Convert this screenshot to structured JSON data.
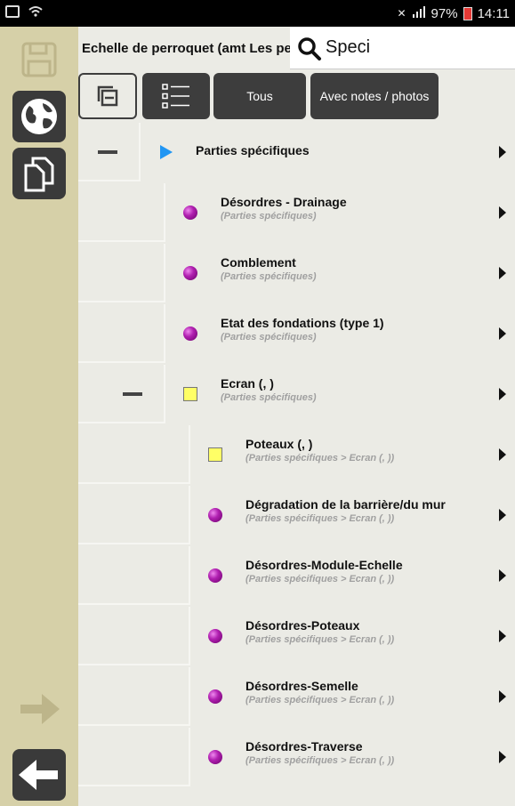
{
  "status": {
    "battery": "97%",
    "time": "14:11"
  },
  "header": {
    "title": "Echelle de perroquet (amt Les petits Bois)",
    "search_value": "Speci"
  },
  "filters": {
    "all_label": "Tous",
    "notes_label": "Avec notes / photos"
  },
  "sidebar_icons": [
    "save-icon",
    "globe-icon",
    "copy-icon",
    "forward-arrow-icon",
    "back-arrow-icon"
  ],
  "tree": [
    {
      "label": "Parties spécifiques",
      "sub": "",
      "marker": "play",
      "level": 0
    },
    {
      "label": "Désordres - Drainage",
      "sub": "(Parties spécifiques)",
      "marker": "ball",
      "level": 1
    },
    {
      "label": "Comblement",
      "sub": "(Parties spécifiques)",
      "marker": "ball",
      "level": 1
    },
    {
      "label": "Etat des fondations (type 1)",
      "sub": "(Parties spécifiques)",
      "marker": "ball",
      "level": 1
    },
    {
      "label": "Ecran (, )",
      "sub": "(Parties spécifiques)",
      "marker": "square",
      "level": 1
    },
    {
      "label": "Poteaux (, )",
      "sub": "(Parties spécifiques > Ecran (, ))",
      "marker": "square",
      "level": 2
    },
    {
      "label": "Dégradation de la barrière/du mur",
      "sub": "(Parties spécifiques > Ecran (, ))",
      "marker": "ball",
      "level": 2
    },
    {
      "label": "Désordres-Module-Echelle",
      "sub": "(Parties spécifiques > Ecran (, ))",
      "marker": "ball",
      "level": 2
    },
    {
      "label": "Désordres-Poteaux",
      "sub": "(Parties spécifiques > Ecran (, ))",
      "marker": "ball",
      "level": 2
    },
    {
      "label": "Désordres-Semelle",
      "sub": "(Parties spécifiques > Ecran (, ))",
      "marker": "ball",
      "level": 2
    },
    {
      "label": "Désordres-Traverse",
      "sub": "(Parties spécifiques > Ecran (, ))",
      "marker": "ball",
      "level": 2
    }
  ],
  "colors": {
    "sidebar": "#d6d0a8",
    "background": "#ebebe5",
    "button_dark": "#3d3d3d",
    "ball": "#b020b0",
    "square": "#ffff66",
    "play": "#2196f3"
  }
}
